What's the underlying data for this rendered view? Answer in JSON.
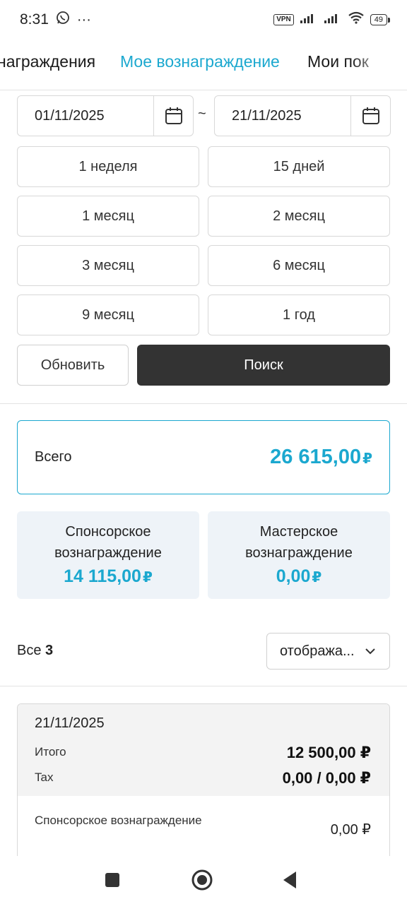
{
  "status_bar": {
    "time": "8:31",
    "dots": "···",
    "vpn": "VPN",
    "battery": "49"
  },
  "tabs": [
    {
      "label": "награждения"
    },
    {
      "label": "Мое вознаграждение"
    },
    {
      "label": "Мои пок"
    }
  ],
  "date_range": {
    "from": "01/11/2025",
    "separator": "~",
    "to": "21/11/2025"
  },
  "periods": [
    "1 неделя",
    "15 дней",
    "1 месяц",
    "2 месяц",
    "3 месяц",
    "6 месяц",
    "9 месяц",
    "1 год"
  ],
  "actions": {
    "refresh": "Обновить",
    "search": "Поиск"
  },
  "summary": {
    "total_label": "Всего",
    "total_value": "26 615,00",
    "currency": "₽",
    "sponsor_title_1": "Спонсорское",
    "sponsor_title_2": "вознаграждение",
    "sponsor_value": "14 115,00",
    "master_title_1": "Мастерское",
    "master_title_2": "вознаграждение",
    "master_value": "0,00"
  },
  "list": {
    "all_label": "Все",
    "count": "3",
    "display_select": "отобража..."
  },
  "record": {
    "date": "21/11/2025",
    "total_label": "Итого",
    "total_value": "12 500,00 ₽",
    "tax_label": "Tax",
    "tax_value": "0,00 / 0,00 ₽",
    "sponsor_label": "Спонсорское вознаграждение",
    "sponsor_value": "0,00 ₽"
  },
  "colors": {
    "accent": "#1ba8cf",
    "dark_button": "#333333",
    "sub_card_bg": "#eef3f8"
  },
  "icons": [
    "whatsapp-icon",
    "vpn-icon",
    "signal-icon",
    "wifi-icon",
    "battery-icon",
    "calendar-icon",
    "chevron-down-icon",
    "recents-icon",
    "home-icon",
    "back-icon"
  ]
}
